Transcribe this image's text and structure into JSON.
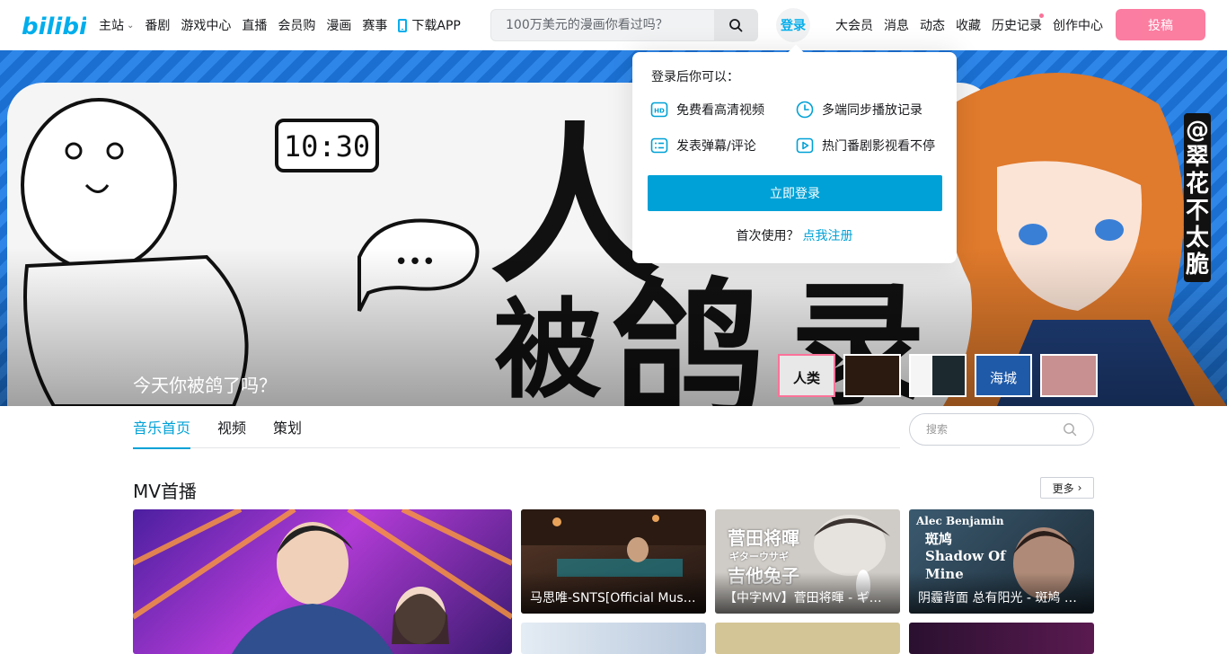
{
  "nav": {
    "logo_text": "bilibili",
    "links": [
      {
        "label": "主站",
        "has_chevron": true
      },
      {
        "label": "番剧"
      },
      {
        "label": "游戏中心"
      },
      {
        "label": "直播"
      },
      {
        "label": "会员购"
      },
      {
        "label": "漫画"
      },
      {
        "label": "赛事"
      },
      {
        "label": "下载APP",
        "icon": "phone-icon"
      }
    ],
    "search_placeholder": "100万美元的漫画你看过吗？",
    "login_label": "登录",
    "right_links": [
      {
        "label": "大会员"
      },
      {
        "label": "消息"
      },
      {
        "label": "动态"
      },
      {
        "label": "收藏"
      },
      {
        "label": "历史记录",
        "has_dot": true
      },
      {
        "label": "创作中心"
      }
    ],
    "upload_label": "投稿"
  },
  "banner": {
    "title": "今天你被鸽了吗？",
    "art_text": {
      "clock": "10:30",
      "big_chars": [
        "人",
        "被",
        "鸽",
        "录"
      ],
      "bubble": "•••",
      "vertical": "@翠花不太脆"
    },
    "thumbnails": [
      {
        "text": "人类",
        "active": true,
        "color": "#e8e8e8"
      },
      {
        "text": "",
        "active": false,
        "color": "#2a1a10"
      },
      {
        "text": "",
        "active": false,
        "color": "#1c2a30"
      },
      {
        "text": "海城",
        "active": false,
        "color": "#1f5aa8"
      },
      {
        "text": "",
        "active": false,
        "color": "#c89090"
      }
    ]
  },
  "login_popover": {
    "title": "登录后你可以：",
    "features": [
      {
        "label": "免费看高清视频",
        "icon": "hd-icon"
      },
      {
        "label": "多端同步播放记录",
        "icon": "clock-icon"
      },
      {
        "label": "发表弹幕/评论",
        "icon": "list-icon"
      },
      {
        "label": "热门番剧影视看不停",
        "icon": "play-icon"
      }
    ],
    "login_button": "立即登录",
    "register_prompt": "首次使用？",
    "register_link": "点我注册"
  },
  "subnav": {
    "tabs": [
      {
        "label": "音乐首页",
        "active": true
      },
      {
        "label": "视频",
        "active": false
      },
      {
        "label": "策划",
        "active": false
      }
    ],
    "search_placeholder": "搜索"
  },
  "section": {
    "title": "MV首播",
    "more_label": "更多",
    "cards": [
      {
        "title": "",
        "color": "#7a3bd0"
      },
      {
        "title": "马思唯-SNTS[Official Music Video]",
        "color": "#3a2a22"
      },
      {
        "title": "【中字MV】菅田将暉 - ギターウサギ",
        "color": "#c9c5c0",
        "overlay": "菅田将暉",
        "overlay2": "ギターウサギ",
        "overlay3": "吉他兔子"
      },
      {
        "title": "阴霾背面 总有阳光 - 斑鸠 Alec Benjamin",
        "color": "#2f4a5e",
        "overlay": "Alec Benjamin",
        "overlay2": "斑鸠",
        "overlay3": "Shadow Of Mine"
      },
      {
        "title": "",
        "color": "#d8e0ea"
      },
      {
        "title": "",
        "color": "#d6c79a"
      },
      {
        "title": "",
        "color": "#3a1a3a"
      }
    ]
  }
}
